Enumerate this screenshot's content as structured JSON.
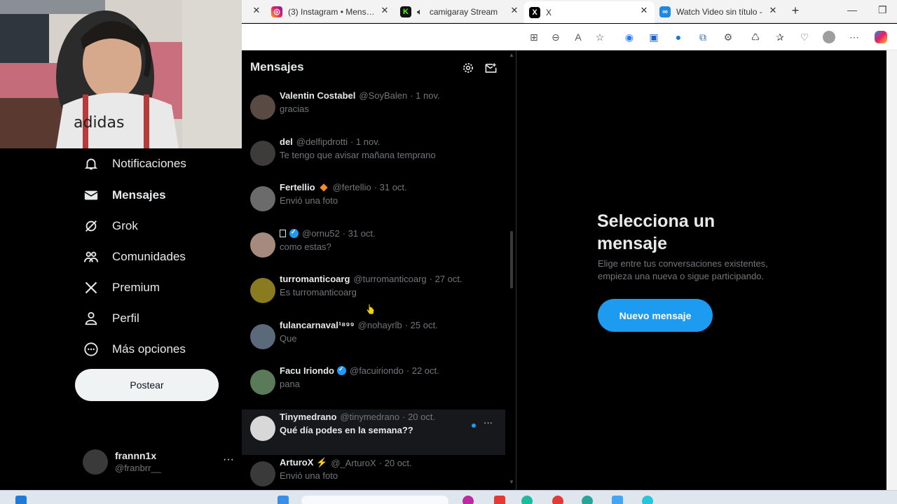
{
  "browser": {
    "tabs": [
      {
        "title": "",
        "icon": "x-icon"
      },
      {
        "title": "(3) Instagram • Mensaje",
        "icon": "instagram-icon"
      },
      {
        "title": "camigaray Stream",
        "icon": "kick-icon"
      },
      {
        "title": "X",
        "icon": "x-icon"
      },
      {
        "title": "Watch Video sin título -",
        "icon": "watch-video-icon"
      }
    ],
    "new_tab_label": "+"
  },
  "webcam": {
    "shirt_text": "adidas"
  },
  "nav": {
    "items": [
      {
        "label": "Notificaciones",
        "icon": "bell-icon"
      },
      {
        "label": "Mensajes",
        "icon": "envelope-icon",
        "active": true
      },
      {
        "label": "Grok",
        "icon": "grok-icon"
      },
      {
        "label": "Comunidades",
        "icon": "communities-icon"
      },
      {
        "label": "Premium",
        "icon": "x-logo-icon"
      },
      {
        "label": "Perfil",
        "icon": "person-icon"
      },
      {
        "label": "Más opciones",
        "icon": "more-circle-icon"
      }
    ],
    "post_label": "Postear",
    "profile": {
      "name": "frannn1x",
      "handle": "@franbrr__",
      "more": "···"
    }
  },
  "messages": {
    "title": "Mensajes",
    "conversations": [
      {
        "name": "Valentin Costabel",
        "handle": "@SoyBalen",
        "date": "· 1 nov.",
        "preview": "gracias",
        "avatar_color": "#5a4a44"
      },
      {
        "name": "del",
        "handle": "@delfipdrotti",
        "date": "· 1 nov.",
        "preview": "Te tengo que avisar mañana temprano",
        "avatar_color": "#3e3b3b"
      },
      {
        "name": "Fertellio",
        "handle": "@fertellio",
        "date": "· 31 oct.",
        "preview": "Envió una foto",
        "avatar_color": "#6b6b6b",
        "badge": "diamond"
      },
      {
        "name": "",
        "handle": "@ornu52",
        "date": "· 31 oct.",
        "preview": "como estas?",
        "avatar_color": "#a68a7e",
        "verified": true,
        "box": true
      },
      {
        "name": "turromanticoarg",
        "handle": "@turromanticoarg",
        "date": "· 27 oct.",
        "preview": "Es turromanticoarg",
        "avatar_color": "#8a7a20"
      },
      {
        "name": "fulancarnaval¹⁸⁹⁹",
        "handle": "@nohayrlb",
        "date": "· 25 oct.",
        "preview": "Que",
        "avatar_color": "#5a6a7a"
      },
      {
        "name": "Facu Iriondo",
        "handle": "@facuiriondo",
        "date": "· 22 oct.",
        "preview": "pana",
        "avatar_color": "#5a7a5a",
        "verified": true
      },
      {
        "name": "Tinymedrano",
        "handle": "@tinymedrano",
        "date": "· 20 oct.",
        "preview": "Qué día podes en la semana??",
        "avatar_color": "#d8d8d8",
        "unread": true,
        "more": "···"
      },
      {
        "name": "ArturoX ⚡",
        "handle": "@_ArturoX",
        "date": "· 20 oct.",
        "preview": "Envió una foto",
        "avatar_color": "#3a3a3a"
      }
    ]
  },
  "detail": {
    "title": "Selecciona un mensaje",
    "subtitle": "Elige entre tus conversaciones existentes, empieza una nueva o sigue participando.",
    "button_label": "Nuevo mensaje"
  },
  "colors": {
    "accent": "#1d9bf0",
    "background": "#000000",
    "muted": "#71767b",
    "text": "#e7e9ea"
  }
}
